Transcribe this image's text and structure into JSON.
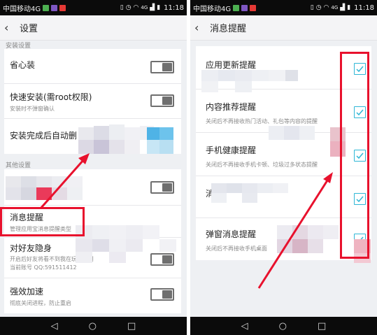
{
  "status_bar": {
    "carrier": "中国移动4G",
    "network": "4G",
    "time": "11:18"
  },
  "left": {
    "title": "设置",
    "section_install": "安装设置",
    "section_other": "其他设置",
    "rows": [
      {
        "title": "省心装",
        "subtitle": ""
      },
      {
        "title": "快速安装(需root权限)",
        "subtitle": "安装时不弹窗确认"
      },
      {
        "title": "安装完成后自动删",
        "subtitle": ""
      },
      {
        "title": "消息提醒",
        "subtitle": "管理应用宝消息提醒类型"
      },
      {
        "title": "对好友隐身",
        "subtitle": "开启后好友将看不到我在玩的应用",
        "subtitle2": "当前账号   QQ:591511412"
      },
      {
        "title": "强效加速",
        "subtitle": "彻底关闭进程，防止重启"
      }
    ]
  },
  "right": {
    "title": "消息提醒",
    "items": [
      {
        "title": "应用更新提醒",
        "subtitle": ""
      },
      {
        "title": "内容推荐提醒",
        "subtitle": "关闭后不再接收热门活动、礼包等内容的提醒"
      },
      {
        "title": "手机健康提醒",
        "subtitle": "关闭后不再接收手机卡顿、垃圾过多状态提醒"
      },
      {
        "title": "消",
        "subtitle": ""
      },
      {
        "title": "弹窗消息提醒",
        "subtitle": "关闭后不再接收手机桌面"
      }
    ]
  },
  "colors": {
    "highlight": "#e8112d",
    "checkbox": "#2fb7d6",
    "toggle": "#6f6f6f"
  },
  "icons": {
    "back": "back-arrow-icon",
    "nav_back": "triangle-back-icon",
    "nav_home": "circle-home-icon",
    "nav_recent": "square-recent-icon"
  }
}
